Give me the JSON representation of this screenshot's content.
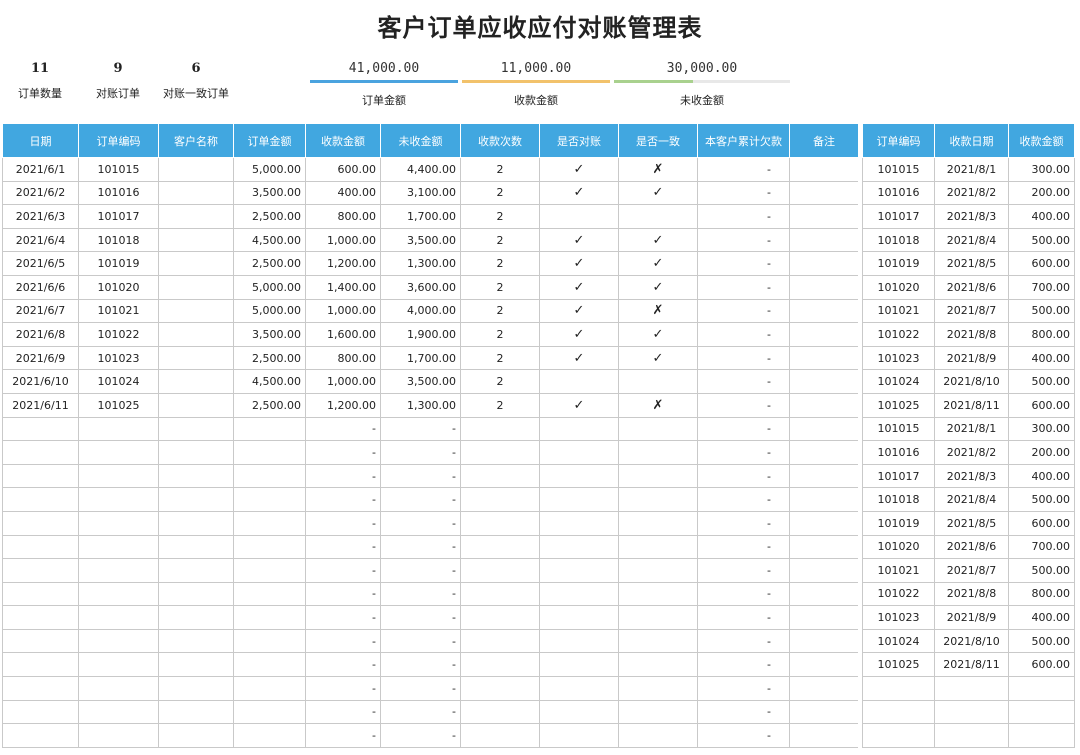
{
  "title": "客户订单应收应付对账管理表",
  "stats": [
    {
      "value": "11",
      "label": "订单数量"
    },
    {
      "value": "9",
      "label": "对账订单"
    },
    {
      "value": "6",
      "label": "对账一致订单"
    }
  ],
  "amounts": [
    {
      "value": "41,000.00",
      "label": "订单金额",
      "color": "#4aa3df"
    },
    {
      "value": "11,000.00",
      "label": "收款金额",
      "color": "#f2c26b"
    },
    {
      "value": "30,000.00",
      "label": "未收金额",
      "color": "#a9d18e"
    }
  ],
  "left_table": {
    "headers": [
      "日期",
      "订单编码",
      "客户名称",
      "订单金额",
      "收款金额",
      "未收金额",
      "收款次数",
      "是否对账",
      "是否一致",
      "本客户累计欠款",
      "备注"
    ],
    "rows": [
      [
        "2021/6/1",
        "101015",
        "",
        "5,000.00",
        "600.00",
        "4,400.00",
        "2",
        "✓",
        "✗",
        "-",
        ""
      ],
      [
        "2021/6/2",
        "101016",
        "",
        "3,500.00",
        "400.00",
        "3,100.00",
        "2",
        "✓",
        "✓",
        "-",
        ""
      ],
      [
        "2021/6/3",
        "101017",
        "",
        "2,500.00",
        "800.00",
        "1,700.00",
        "2",
        "",
        "",
        "-",
        ""
      ],
      [
        "2021/6/4",
        "101018",
        "",
        "4,500.00",
        "1,000.00",
        "3,500.00",
        "2",
        "✓",
        "✓",
        "-",
        ""
      ],
      [
        "2021/6/5",
        "101019",
        "",
        "2,500.00",
        "1,200.00",
        "1,300.00",
        "2",
        "✓",
        "✓",
        "-",
        ""
      ],
      [
        "2021/6/6",
        "101020",
        "",
        "5,000.00",
        "1,400.00",
        "3,600.00",
        "2",
        "✓",
        "✓",
        "-",
        ""
      ],
      [
        "2021/6/7",
        "101021",
        "",
        "5,000.00",
        "1,000.00",
        "4,000.00",
        "2",
        "✓",
        "✗",
        "-",
        ""
      ],
      [
        "2021/6/8",
        "101022",
        "",
        "3,500.00",
        "1,600.00",
        "1,900.00",
        "2",
        "✓",
        "✓",
        "-",
        ""
      ],
      [
        "2021/6/9",
        "101023",
        "",
        "2,500.00",
        "800.00",
        "1,700.00",
        "2",
        "✓",
        "✓",
        "-",
        ""
      ],
      [
        "2021/6/10",
        "101024",
        "",
        "4,500.00",
        "1,000.00",
        "3,500.00",
        "2",
        "",
        "",
        "-",
        ""
      ],
      [
        "2021/6/11",
        "101025",
        "",
        "2,500.00",
        "1,200.00",
        "1,300.00",
        "2",
        "✓",
        "✗",
        "-",
        ""
      ],
      [
        "",
        "",
        "",
        "",
        "-",
        "-",
        "",
        "",
        "",
        "-",
        ""
      ],
      [
        "",
        "",
        "",
        "",
        "-",
        "-",
        "",
        "",
        "",
        "-",
        ""
      ],
      [
        "",
        "",
        "",
        "",
        "-",
        "-",
        "",
        "",
        "",
        "-",
        ""
      ],
      [
        "",
        "",
        "",
        "",
        "-",
        "-",
        "",
        "",
        "",
        "-",
        ""
      ],
      [
        "",
        "",
        "",
        "",
        "-",
        "-",
        "",
        "",
        "",
        "-",
        ""
      ],
      [
        "",
        "",
        "",
        "",
        "-",
        "-",
        "",
        "",
        "",
        "-",
        ""
      ],
      [
        "",
        "",
        "",
        "",
        "-",
        "-",
        "",
        "",
        "",
        "-",
        ""
      ],
      [
        "",
        "",
        "",
        "",
        "-",
        "-",
        "",
        "",
        "",
        "-",
        ""
      ],
      [
        "",
        "",
        "",
        "",
        "-",
        "-",
        "",
        "",
        "",
        "-",
        ""
      ],
      [
        "",
        "",
        "",
        "",
        "-",
        "-",
        "",
        "",
        "",
        "-",
        ""
      ],
      [
        "",
        "",
        "",
        "",
        "-",
        "-",
        "",
        "",
        "",
        "-",
        ""
      ],
      [
        "",
        "",
        "",
        "",
        "-",
        "-",
        "",
        "",
        "",
        "-",
        ""
      ],
      [
        "",
        "",
        "",
        "",
        "-",
        "-",
        "",
        "",
        "",
        "-",
        ""
      ],
      [
        "",
        "",
        "",
        "",
        "-",
        "-",
        "",
        "",
        "",
        "-",
        ""
      ]
    ]
  },
  "right_table": {
    "headers": [
      "订单编码",
      "收款日期",
      "收款金额"
    ],
    "rows": [
      [
        "101015",
        "2021/8/1",
        "300.00"
      ],
      [
        "101016",
        "2021/8/2",
        "200.00"
      ],
      [
        "101017",
        "2021/8/3",
        "400.00"
      ],
      [
        "101018",
        "2021/8/4",
        "500.00"
      ],
      [
        "101019",
        "2021/8/5",
        "600.00"
      ],
      [
        "101020",
        "2021/8/6",
        "700.00"
      ],
      [
        "101021",
        "2021/8/7",
        "500.00"
      ],
      [
        "101022",
        "2021/8/8",
        "800.00"
      ],
      [
        "101023",
        "2021/8/9",
        "400.00"
      ],
      [
        "101024",
        "2021/8/10",
        "500.00"
      ],
      [
        "101025",
        "2021/8/11",
        "600.00"
      ],
      [
        "101015",
        "2021/8/1",
        "300.00"
      ],
      [
        "101016",
        "2021/8/2",
        "200.00"
      ],
      [
        "101017",
        "2021/8/3",
        "400.00"
      ],
      [
        "101018",
        "2021/8/4",
        "500.00"
      ],
      [
        "101019",
        "2021/8/5",
        "600.00"
      ],
      [
        "101020",
        "2021/8/6",
        "700.00"
      ],
      [
        "101021",
        "2021/8/7",
        "500.00"
      ],
      [
        "101022",
        "2021/8/8",
        "800.00"
      ],
      [
        "101023",
        "2021/8/9",
        "400.00"
      ],
      [
        "101024",
        "2021/8/10",
        "500.00"
      ],
      [
        "101025",
        "2021/8/11",
        "600.00"
      ],
      [
        "",
        "",
        ""
      ],
      [
        "",
        "",
        ""
      ],
      [
        "",
        "",
        ""
      ]
    ]
  }
}
